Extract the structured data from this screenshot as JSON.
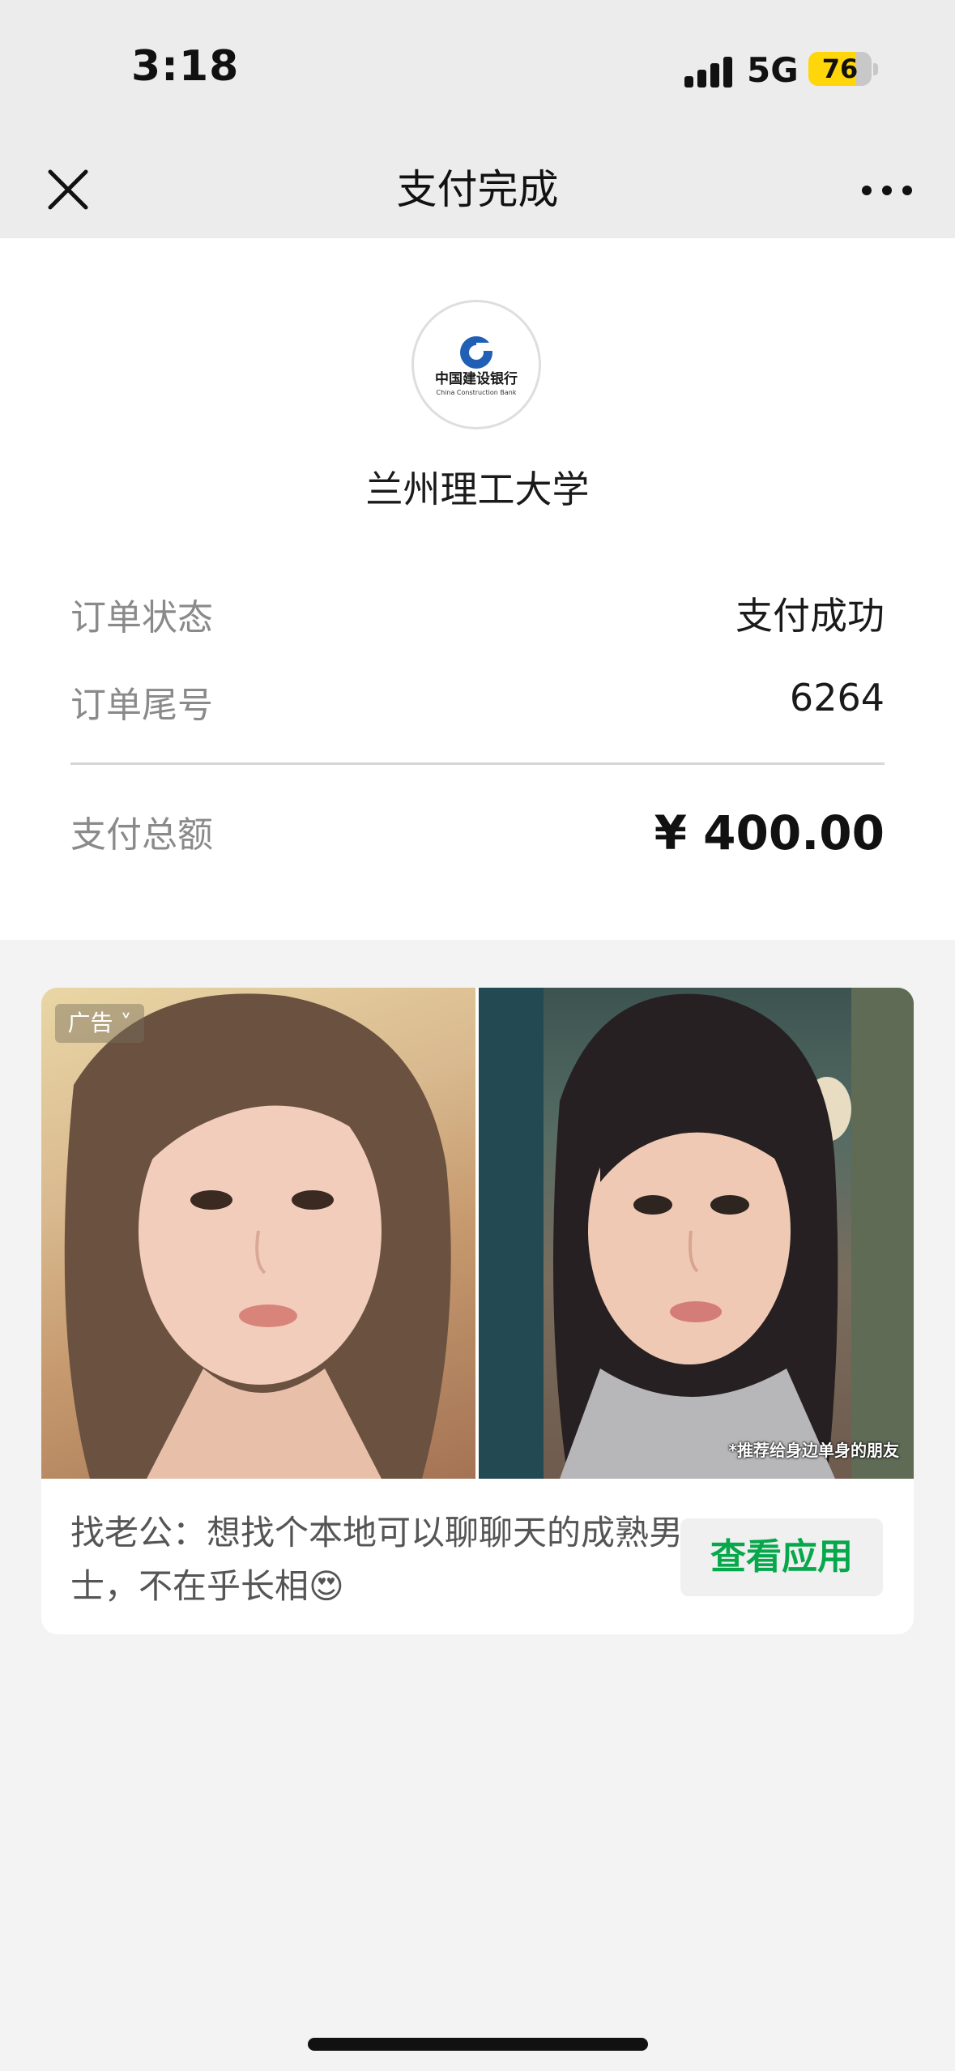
{
  "status_bar": {
    "time": "3:18",
    "network": "5G",
    "battery": "76",
    "battery_level": 0.76
  },
  "nav": {
    "title": "支付完成",
    "close_icon": "close-icon",
    "more_icon": "more-icon"
  },
  "payment": {
    "bank_logo": {
      "icon": "ccb-logo-icon",
      "name_cn": "中国建设银行",
      "name_en": "China Construction Bank"
    },
    "merchant": "兰州理工大学",
    "rows": [
      {
        "label": "订单状态",
        "value": "支付成功"
      },
      {
        "label": "订单尾号",
        "value": "6264"
      }
    ],
    "total_label": "支付总额",
    "total_amount": "¥ 400.00"
  },
  "ad": {
    "tag": "广告",
    "image_caption": "*推荐给身边单身的朋友",
    "description": "找老公：想找个本地可以聊聊天的成熟男士，不在乎长相😍",
    "button": "查看应用",
    "button_color": "#07a84b"
  }
}
